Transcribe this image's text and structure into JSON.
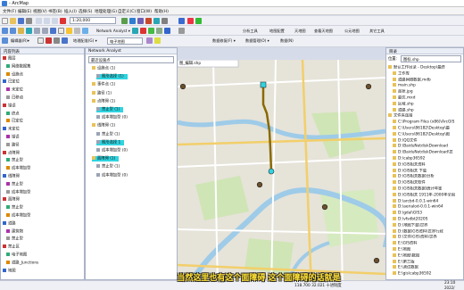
{
  "window": {
    "title": "- ArcMap"
  },
  "menu": {
    "items": [
      "文件(F)",
      "编辑(E)",
      "视图(V)",
      "书签(B)",
      "插入(I)",
      "选择(S)",
      "地理处理(G)",
      "自定义(C)",
      "窗口(W)",
      "帮助(H)"
    ]
  },
  "toolbar": {
    "scale_value": "1:20,000",
    "network_analyst_label": "Network Analyst ▾",
    "right_labels": [
      "分析工具",
      "地图配置",
      "天地图",
      "查看天地图",
      "公元地图",
      "其它工具"
    ],
    "row3_labels": [
      "数据修复(F) ▾",
      "数据管理(O) ▾",
      "数据(N)"
    ],
    "editor_label": "编辑器(R)▾",
    "georef_label": "地理配准(G) ▾",
    "layer_dropdown": "电子地图"
  },
  "toc": {
    "title": "内容列表",
    "rows": [
      {
        "text": "图层",
        "hl": false
      },
      {
        "text": "网络数据集",
        "hl": false
      },
      {
        "text": "设施点",
        "hl": false
      },
      {
        "text": "已定位",
        "hl": false
      },
      {
        "text": "未定位",
        "hl": false
      },
      {
        "text": "已移动",
        "hl": false
      },
      {
        "text": "错误",
        "hl": false
      },
      {
        "text": "终点",
        "hl": false
      },
      {
        "text": "已定位",
        "hl": false
      },
      {
        "text": "未定位",
        "hl": false
      },
      {
        "text": "错误",
        "hl": false
      },
      {
        "text": "路径",
        "hl": false
      },
      {
        "text": "点障碍",
        "hl": false
      },
      {
        "text": "禁止型",
        "hl": false
      },
      {
        "text": "成本增加型",
        "hl": false
      },
      {
        "text": "线障碍",
        "hl": false
      },
      {
        "text": "禁止型",
        "hl": false
      },
      {
        "text": "成本增加型",
        "hl": false
      },
      {
        "text": "面障碍",
        "hl": false
      },
      {
        "text": "禁止型",
        "hl": false
      },
      {
        "text": "成本增加型",
        "hl": false
      },
      {
        "text": "道路",
        "hl": false
      },
      {
        "text": "建筑物",
        "hl": false
      },
      {
        "text": "禁止型",
        "hl": false
      },
      {
        "text": "禁止区",
        "hl": false
      },
      {
        "text": "电子地图",
        "hl": false
      },
      {
        "text": "道路_Junctions",
        "hl": false
      },
      {
        "text": "地图",
        "hl": false
      }
    ]
  },
  "network_analyst": {
    "title": "Network Analyst",
    "dropdown": "最近设施点",
    "rows": [
      {
        "text": "设施点 (1)",
        "indent": 1,
        "hl": false
      },
      {
        "text": "图形选择 (1)",
        "indent": 2,
        "hl": true
      },
      {
        "text": "事件点 (1)",
        "indent": 1,
        "hl": false
      },
      {
        "text": "路径 (1)",
        "indent": 1,
        "hl": false
      },
      {
        "text": "点障碍 (1)",
        "indent": 1,
        "hl": false
      },
      {
        "text": "禁止型 (1)",
        "indent": 2,
        "hl": true
      },
      {
        "text": "成本增加型 (0)",
        "indent": 2,
        "hl": false
      },
      {
        "text": "线障碍 (1)",
        "indent": 1,
        "hl": false
      },
      {
        "text": "禁止型 (1)",
        "indent": 2,
        "hl": false
      },
      {
        "text": "图形选择 1",
        "indent": 2,
        "hl": true
      },
      {
        "text": "成本增加型 (0)",
        "indent": 2,
        "hl": false
      },
      {
        "text": "面障碍 (1)",
        "indent": 1,
        "hl": true
      },
      {
        "text": "禁止型 (1)",
        "indent": 2,
        "hl": false
      },
      {
        "text": "成本增加型 (0)",
        "indent": 2,
        "hl": false
      }
    ]
  },
  "catalog": {
    "title": "目录",
    "location_label": "位置:",
    "location_value": "图标.shp",
    "rows": [
      "默认工作目录 - Desktop\\最终",
      "工作库",
      "道路网络数据.mdb",
      "main.shp",
      "面状.jpg",
      "最优.mxd",
      "区域.shp",
      "道路.shp",
      "文件夹连接",
      "C:\\Program Files (x86)\\ArcGIS",
      "C:\\Users\\86182\\Desktop\\最",
      "C:\\Users\\86182\\Desktop\\图",
      "D:\\QQ文件",
      "D:\\BaiduNetdiskDownload",
      "D:\\BaiduNetdiskDownload\\世",
      "D:\\cabp36592",
      "D:\\GIS相关资料",
      "D:\\GIS相关 下载",
      "D:\\GIS相关数据\\分析",
      "D:\\GIS相关软件",
      "D:\\GIS相关数据\\统计年鉴",
      "D:\\GIS相关 1911年-2000年全国",
      "D:\\arcbd-0.0.1-win64",
      "D:\\aerialod-0.0.1-win64",
      "D:\\gdal\\GIS3",
      "D:\\vfsdbt2020S",
      "D:\\地图下载\\世界",
      "D:\\数据\\GIS资料\\世界行政",
      "D:\\文件\\GIS\\资料\\世界",
      "E:\\GIS资料",
      "E:\\地图",
      "E:\\地图\\数据",
      "E:\\第三版",
      "E:\\测试数据",
      "E:\\gis\\cabp36592"
    ]
  },
  "status": {
    "coords": "118.700  32.021  十进制度",
    "clock_time": "23:10",
    "clock_date": "2022/"
  },
  "subtitle": "当然这里也有这个面障碍 这个面障碍的话就是",
  "map_tab": "图_编辑.shp",
  "colors": {
    "highlight": "#2fd4e0",
    "route": "#8a6a00",
    "subtitle": "#ffe033"
  }
}
